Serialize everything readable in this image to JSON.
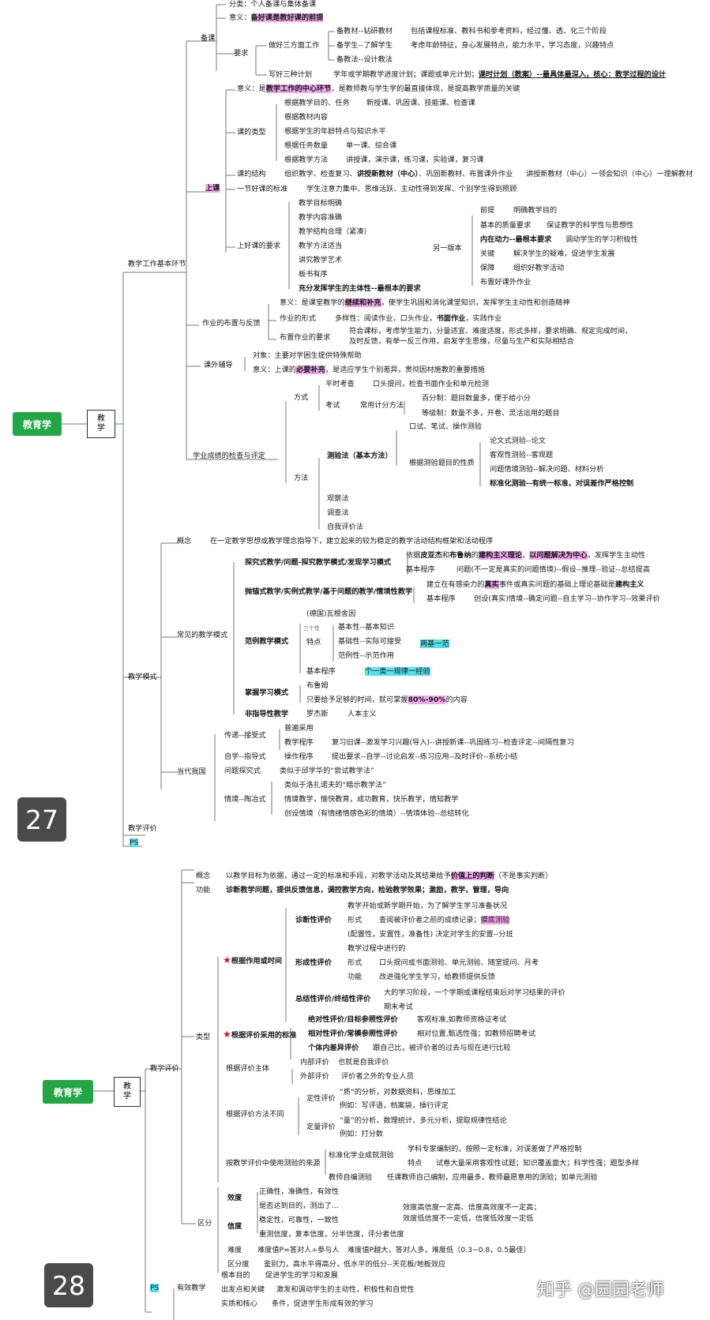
{
  "p1": {
    "page_number": "27",
    "root": "教育学",
    "level1": "教\n学",
    "sec_basic": "教学工作基本环节",
    "prep": {
      "label": "备课",
      "kinds": "分类：个人备课与集体备课",
      "meaning_a": "意义：",
      "meaning_b": "备好课是教好课的前提",
      "req": "要求",
      "three": "做好三方面工作",
      "jc": "备教材--钻研教材",
      "jc_d": "包括课程标准、教科书和参考资料，经过懂、透、化三个阶段",
      "xs": "备学生--了解学生",
      "xs_d": "考虑年龄特征，身心发展特点，能力水平，学习态度，兴趣特点",
      "jf": "备教法--设计教法",
      "plan": "写好三种计划",
      "plan_a": "学年或学期教学进度计划；课题或单元计划；",
      "plan_b": "课时计划（教案）--最具体最深入，核心：教学过程的设计"
    },
    "lesson": {
      "label": "上课",
      "m_a": "意义：是",
      "m_b": "教学工作的中心环节",
      "m_c": "，是教师教与学生学的最直接体现，是提高教学质量的关键",
      "types": "课的类型",
      "t1": "根据教学目的、任务",
      "t1d": "新授课、巩固课、技能课、检查课",
      "t2": "根据教材内容",
      "t3": "根据学生的年龄特点与知识水平",
      "t4": "根据任务数量",
      "t4d": "单一课、综合课",
      "t5": "根据教学方法",
      "t5d": "讲授课，演示课，练习课，实验课，复习课",
      "struct": "课的结构",
      "struct_a": "组织教学、检查复习、",
      "struct_b": "讲授新教材（中心）",
      "struct_c": "、巩固新教材、布置课外作业",
      "struct_2": "讲授新教材（中心）一领会知识（中心）一理解教材",
      "std": "一节好课的标准",
      "std_d": "学生注意力集中、思维活跃、主动性得到发挥、个别学生得到照顾",
      "good": "上好课的要求",
      "g": [
        "教学目标明确",
        "教学内容准确",
        "教学结构合理（紧凑）",
        "教学方法适当",
        "讲究教学艺术",
        "板书有序"
      ],
      "g7": "充分发挥学生的主体性--最根本的要求",
      "alt": "另一版本",
      "a1": "前提",
      "a1d": "明确教学目的",
      "a2": "基本的质量要求",
      "a2d": "保证教学的科学性与思想性",
      "a3": "内在动力--最根本要求",
      "a3d": "调动学生的学习积极性",
      "a4": "关键",
      "a4d": "解决学生的疑难，促进学生发展",
      "a5": "保障",
      "a5d": "组织好教学活动",
      "a6": "布置好课外作业"
    },
    "hw": {
      "label": "作业的布置与反馈",
      "m_a": "意义：是课堂教学的",
      "m_b": "继续和补充",
      "m_c": "，使学生巩固和消化课堂知识，发挥学生主动性和创造精神",
      "form": "作业的形式",
      "form_a": "多样性：阅读作业，口头作业，",
      "form_b": "书面作业",
      "form_c": "，实践作业",
      "req": "布置作业的要求",
      "req1": "符合课标，考虑学生能力，分量适宜、难度适度，形式多样，要求明确、规定完成时间，",
      "req2": "及时反馈，有举一反三作用，启发学生思维，尽量与生产和实际相结合"
    },
    "tutor": {
      "label": "课外辅导",
      "target": "对象：主要对学困生提供特殊帮助",
      "m_a": "意义：上课的",
      "m_b": "必要补充",
      "m_c": "，是适应学生个别差异，贯彻因材施教的重要措施"
    },
    "assess": {
      "label": "学业成绩的检查与评定",
      "mode": "方式",
      "ps": "平时考查",
      "ps_d": "口头提问，检查书面作业和单元检测",
      "exam": "考试",
      "exam_d": "常用计分方法",
      "bai": "百分制：题目数量多，便于给小分",
      "dj": "等级制：数量不多，开卷、灵活运用的题目",
      "method": "方法",
      "test": "测验法（基本方法）",
      "kb": "口试、笔试、操作测验",
      "by": "根据测验题目的性质",
      "lw": "论文式测验--论文",
      "kg": "客观性测验--客观题",
      "wt": "问题情境测验--解决问题、材料分析",
      "bz": "标准化测验--有统一标准，对误差作严格控制",
      "gc": "观察法",
      "dc": "调查法",
      "zw": "自我评价法"
    },
    "sec_mode": "教学模式",
    "concept": "概念",
    "concept_d": "在一定教学思想或教学理念指导下，建立起来的较为稳定的教学活动结构框架和活动程序",
    "common": "常见的教学模式",
    "tj": "探究式教学/问题-探究教学模式/发现学习模式",
    "tj_a1": "依据",
    "tj_a2": "皮亚杰",
    "tj_a3": "和",
    "tj_a4": "布鲁纳",
    "tj_a5": "的",
    "tj_a6": "建构主义理论",
    "tj_a7": "，",
    "tj_a8": "以问题解决为中心",
    "tj_a9": "，发挥学生主动性",
    "tj_p": "基本程序",
    "tj_pd": "问题(不一定是真实的问题情境)--假设--推理--验证--总结提高",
    "pm": "抛锚式教学/实例式教学/基于问题的教学/情境性教学",
    "pm_a1": "建立在有感染力的",
    "pm_a2": "真实",
    "pm_a3": "事件或真实问题的基础上理论基础是",
    "pm_a4": "建构主义",
    "pm_p": "基本程序",
    "pm_pd": "创设(真实)情境--确定问题--自主学习--协作学习--效果评价",
    "fl": "范例教学模式",
    "fl_de": "(德国)瓦根舍因",
    "fl_tz": "特点",
    "fl_1": "基本性--基本知识",
    "fl_2": "基础性--实际可接受",
    "fl_3": "范例性--示范作用",
    "fl_3x": "三个性",
    "fl_2b": "两基一范",
    "fl_p": "基本程序",
    "fl_pd": "个一类一规律一经验",
    "zw_m": "掌握学习模式",
    "zw_1": "布鲁姆",
    "zw_2a": "只要给予足够的时间，就可掌握",
    "zw_2b": "80%-90%",
    "zw_2c": "的内容",
    "fz": "非指导性教学",
    "fz_1": "罗杰斯",
    "fz_2": "人本主义",
    "cn": "当代我国",
    "cd": "传递--接受式",
    "cd1": "普遍采用",
    "cd2": "教学程序",
    "cd2d": "复习旧课--激发学习兴趣(导入)--讲授新课--巩固练习--检查评定--间隔性复习",
    "zx": "自学--指导式",
    "zx1": "操作程序",
    "zx1d": "提出要求--自学--讨论启发--练习应用--及时评价--系统小结",
    "wt_m": "问题探究式",
    "wt_md": "类似于邱学华的“尝试教学法”",
    "qj": "情境--陶冶式",
    "qj1": "类似于洛扎诺夫的“暗示教学法”",
    "qj2": "情境教学，愉快教育，成功教育，快乐教学，情知教学",
    "qj3": "创设情境（有情绪情感色彩的情境）--情境体验--总结转化",
    "eval": "教学评价",
    "ps": "PS"
  },
  "p2": {
    "page_number": "28",
    "root": "教育学",
    "level1": "教\n学",
    "eval": "教学评价",
    "concept": "概念",
    "concept_a": "以教学目标为依据，通过一定的标准和手段，对教学活动及其结果给予",
    "concept_b": "价值上的判断",
    "concept_c": "（不是事实判断）",
    "func": "功能",
    "func_a": "诊断教学问题，提供反馈信息，调控教学方向，检验教学效果；",
    "func_b": "激励，教学，管理，导向",
    "type": "类型",
    "by_role": "根据作用或时间",
    "zd": "诊断性评价",
    "zd1": "教学开始或新学期开始，为了解学生学习准备状况",
    "zd2": "形式",
    "zd2d": "查阅被评价者之前的成绩记录；",
    "zd2e": "摸底测验",
    "zd3": "(配置性，安置性，准备性) 决定对学生的安置--分班",
    "xc": "形成性评价",
    "xc1": "教学过程中进行的",
    "xc2": "形式",
    "xc2d": "口头提问或书面测验、单元测验、随堂提问、月考",
    "xc3": "功能",
    "xc3d": "改进强化学生学习，给教师提供反馈",
    "zj": "总结性评价/终结性评价",
    "zj1": "大的学习阶段，一个学期或课程结束后对学习结果的评价",
    "zj2": "期末考试",
    "by_std": "根据评价采用的标准",
    "jd": "绝对性评价/目标参照性评价",
    "jd_d": "客观标准,如教师资格证考试",
    "xd": "相对性评价/常模参照性评价",
    "xd_d": "相对位置,甄选性强；如教师招聘考试",
    "gt": "个体内差异评价",
    "gt_d": "跟自己比，被评价者的过去与现在进行比较",
    "by_subj": "根据评价主体",
    "nb": "内部评价",
    "nb_d": "也就是自我评价",
    "wb": "外部评价",
    "wb_d": "评价者之外的专业人员",
    "by_meth": "根据评价方法不同",
    "dx": "定性评价",
    "dx1": "“质”的分析，对数据资料，思维加工",
    "dx2": "例如：写评语，档案袋，操行评定",
    "dl": "定量评价",
    "dl1": "“量”的分析，数理统计、多元分析，提取规律性结论",
    "dl2": "例如：打分数",
    "by_src": "按教学评价中使用测验的来源",
    "bzh": "标准化学业成就测验",
    "bzh1": "学科专家编制的，按照一定标准，对误差做了严格控制",
    "bzh2": "特点",
    "bzh2d": "试卷大量采用客观性试题；知识覆盖面大；科学性强；题型多样",
    "js": "教师自编测验",
    "js_d": "任课教师自己编制，应用最多，教师最愿意用的测验；如单元测验",
    "qf": "区分",
    "xd2": "效度",
    "xd2a": "正确性，准确性，有效性",
    "xd2b": "是否达到目的，测出了...",
    "xdu": "信度",
    "xdu_a": "稳定性，可靠性，一致性",
    "xdu_b": "重测信度，复本信度，分半信度，评分者信度",
    "rel1": "效度高信度一定高、信度高效度不一定高；",
    "rel2": "效度低信度不一定低，信度低效度一定低",
    "nd": "难度",
    "nd_a": "难度值P=答对人÷参与人",
    "nd_b": "难度值P越大，答对人多，难度低（0.3~0.8，0.5最佳）",
    "qfd": "区分度",
    "qfd_a": "鉴别力，高水平得高分，低水平的低分--天花板/地板效应",
    "ps": "PS",
    "yx": "有效教学",
    "yx1": "根本目的",
    "yx1d": "促进学生的学习和发展",
    "yx2": "出发点和关键",
    "yx2d": "激发和调动学生的主动性，积极性和自觉性",
    "yx3": "实质和核心",
    "yx3d": "条件，促进学生形成有效的学习"
  },
  "watermark": "知乎 @园园老师"
}
